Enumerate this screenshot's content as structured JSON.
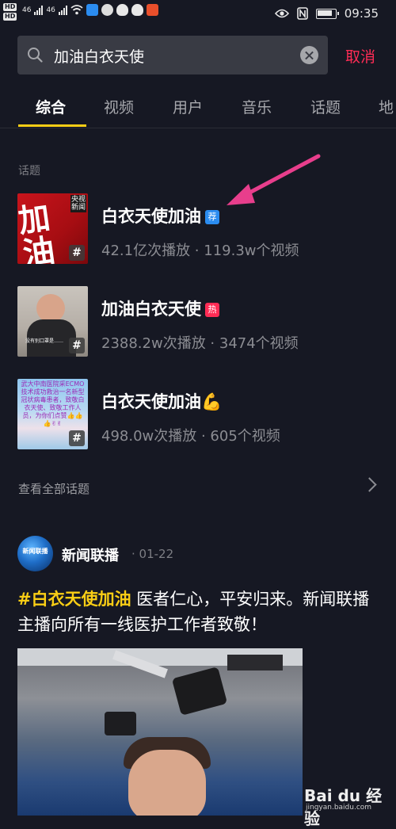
{
  "status_bar": {
    "time": "09:35",
    "hd_top": "HD",
    "hd_bottom": "HD",
    "sig1": "46",
    "sig2": "46",
    "icons": [
      "wifi-icon",
      "eye-icon",
      "nfc-icon",
      "battery-icon"
    ]
  },
  "search": {
    "query": "加油白衣天使",
    "cancel_label": "取消"
  },
  "tabs": [
    {
      "label": "综合",
      "active": true
    },
    {
      "label": "视频",
      "active": false
    },
    {
      "label": "用户",
      "active": false
    },
    {
      "label": "音乐",
      "active": false
    },
    {
      "label": "话题",
      "active": false
    },
    {
      "label": "地",
      "active": false
    }
  ],
  "topics_section": {
    "label": "话题",
    "items": [
      {
        "title": "白衣天使加油",
        "badge": "荐",
        "meta": "42.1亿次播放 · 119.3w个视频",
        "thumb_text": "加油",
        "thumb_tag": "央视新闻"
      },
      {
        "title": "加油白衣天使",
        "badge": "热",
        "meta": "2388.2w次播放 · 3474个视频",
        "thumb_caption": "没有别口罩是……"
      },
      {
        "title": "白衣天使加油💪",
        "badge": "",
        "meta": "498.0w次播放 · 605个视频",
        "thumb_caption": "武大中南医院采ECMO技术成功救治一名新型冠状病毒患者，致敬白衣天使、致敬工作人员，为你们点赞👍👍👍✌✌"
      }
    ],
    "view_all_label": "查看全部话题"
  },
  "post": {
    "author": "新闻联播",
    "avatar_text": "新闻联播",
    "date": "· 01-22",
    "hashtag": "#白衣天使加油",
    "text": " 医者仁心，平安归来。新闻联播主播向所有一线医护工作者致敬！"
  },
  "watermark": {
    "brand": "Bai du 经验",
    "url": "jingyan.baidu.com"
  },
  "colors": {
    "background": "#161823",
    "accent_red": "#fe2c55",
    "accent_yellow": "#face15",
    "search_bg": "#393b44"
  }
}
